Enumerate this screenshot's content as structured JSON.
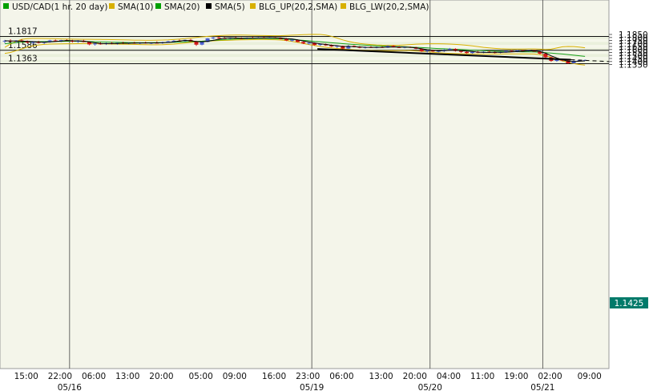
{
  "chart_data": {
    "type": "line",
    "title": "USD/CAD(1 hr. 20 day)",
    "legend": [
      {
        "label": "USD/CAD(1 hr. 20 day)",
        "color": "#00a000"
      },
      {
        "label": "SMA(10)",
        "color": "#d8b000"
      },
      {
        "label": "SMA(20)",
        "color": "#00a000"
      },
      {
        "label": "SMA(5)",
        "color": "#000000"
      },
      {
        "label": "BLG_UP(20,2,SMA)",
        "color": "#d8b000"
      },
      {
        "label": "BLG_LW(20,2,SMA)",
        "color": "#d8b000"
      }
    ],
    "legend_position": "top-left",
    "ylim": [
      1.1325,
      1.1895
    ],
    "y_ticks": [
      "1.1850",
      "1.1800",
      "1.1750",
      "1.1700",
      "1.1650",
      "1.1600",
      "1.1550",
      "1.1500",
      "1.1450",
      "1.1400",
      "1.1350"
    ],
    "x_tick_labels": [
      "15:00",
      "22:00",
      "06:00",
      "13:00",
      "20:00",
      "05:00",
      "09:00",
      "16:00",
      "23:00",
      "06:00",
      "13:00",
      "20:00",
      "04:00",
      "11:00",
      "19:00",
      "02:00",
      "09:00"
    ],
    "date_labels": [
      "05/16",
      "05/19",
      "05/20",
      "05/21"
    ],
    "horizontal_lines": [
      {
        "label": "1.1817",
        "value": 1.1817
      },
      {
        "label": "1.1586",
        "value": 1.1586
      },
      {
        "label": "1.1363",
        "value": 1.1363
      }
    ],
    "current_price": {
      "label": "1.1425",
      "value": 1.1425,
      "color": "#007a6a"
    },
    "up_color": "#4a5fd0",
    "down_color": "#d01818",
    "candles": [
      [
        1.1735,
        1.176,
        1.1705,
        1.1745
      ],
      [
        1.1745,
        1.177,
        1.1725,
        1.1735
      ],
      [
        1.1735,
        1.1755,
        1.171,
        1.175
      ],
      [
        1.175,
        1.177,
        1.172,
        1.173
      ],
      [
        1.173,
        1.175,
        1.1705,
        1.1715
      ],
      [
        1.1715,
        1.173,
        1.1695,
        1.1725
      ],
      [
        1.1725,
        1.1745,
        1.17,
        1.171
      ],
      [
        1.171,
        1.1735,
        1.169,
        1.1728
      ],
      [
        1.1728,
        1.176,
        1.1715,
        1.175
      ],
      [
        1.175,
        1.1765,
        1.173,
        1.174
      ],
      [
        1.174,
        1.176,
        1.1725,
        1.1755
      ],
      [
        1.1755,
        1.177,
        1.174,
        1.1745
      ],
      [
        1.1745,
        1.176,
        1.1715,
        1.173
      ],
      [
        1.173,
        1.1755,
        1.171,
        1.1745
      ],
      [
        1.1745,
        1.176,
        1.172,
        1.1725
      ],
      [
        1.1725,
        1.1735,
        1.167,
        1.1685
      ],
      [
        1.1685,
        1.171,
        1.1665,
        1.17
      ],
      [
        1.17,
        1.172,
        1.168,
        1.169
      ],
      [
        1.169,
        1.1715,
        1.1675,
        1.1705
      ],
      [
        1.1705,
        1.1725,
        1.1685,
        1.1695
      ],
      [
        1.1695,
        1.1715,
        1.168,
        1.171
      ],
      [
        1.171,
        1.173,
        1.169,
        1.17
      ],
      [
        1.17,
        1.1718,
        1.1688,
        1.1712
      ],
      [
        1.1712,
        1.1728,
        1.1695,
        1.1702
      ],
      [
        1.1702,
        1.1722,
        1.169,
        1.1715
      ],
      [
        1.1715,
        1.173,
        1.1698,
        1.1705
      ],
      [
        1.1705,
        1.172,
        1.169,
        1.1712
      ],
      [
        1.1712,
        1.1735,
        1.17,
        1.1708
      ],
      [
        1.1708,
        1.173,
        1.1695,
        1.1722
      ],
      [
        1.1722,
        1.1745,
        1.171,
        1.1735
      ],
      [
        1.1735,
        1.1755,
        1.172,
        1.1745
      ],
      [
        1.1745,
        1.1765,
        1.173,
        1.174
      ],
      [
        1.174,
        1.1765,
        1.173,
        1.176
      ],
      [
        1.176,
        1.1775,
        1.1725,
        1.1735
      ],
      [
        1.1735,
        1.1745,
        1.166,
        1.168
      ],
      [
        1.168,
        1.1735,
        1.167,
        1.1725
      ],
      [
        1.1725,
        1.179,
        1.172,
        1.1785
      ],
      [
        1.1785,
        1.181,
        1.177,
        1.18
      ],
      [
        1.18,
        1.181,
        1.1775,
        1.179
      ],
      [
        1.179,
        1.1808,
        1.1775,
        1.1782
      ],
      [
        1.1782,
        1.18,
        1.177,
        1.1795
      ],
      [
        1.1795,
        1.181,
        1.178,
        1.1788
      ],
      [
        1.1788,
        1.1802,
        1.1775,
        1.178
      ],
      [
        1.178,
        1.18,
        1.177,
        1.1795
      ],
      [
        1.1795,
        1.181,
        1.1785,
        1.179
      ],
      [
        1.179,
        1.1805,
        1.178,
        1.1798
      ],
      [
        1.1798,
        1.1808,
        1.1788,
        1.1792
      ],
      [
        1.1792,
        1.1805,
        1.1782,
        1.18
      ],
      [
        1.18,
        1.1806,
        1.1785,
        1.179
      ],
      [
        1.179,
        1.18,
        1.177,
        1.1775
      ],
      [
        1.1775,
        1.179,
        1.174,
        1.175
      ],
      [
        1.175,
        1.177,
        1.173,
        1.176
      ],
      [
        1.176,
        1.1765,
        1.172,
        1.1725
      ],
      [
        1.1725,
        1.1735,
        1.169,
        1.17
      ],
      [
        1.17,
        1.172,
        1.168,
        1.171
      ],
      [
        1.171,
        1.1718,
        1.1665,
        1.1675
      ],
      [
        1.1675,
        1.17,
        1.166,
        1.169
      ],
      [
        1.169,
        1.17,
        1.166,
        1.1668
      ],
      [
        1.1668,
        1.1685,
        1.164,
        1.165
      ],
      [
        1.165,
        1.167,
        1.1625,
        1.166
      ],
      [
        1.166,
        1.1665,
        1.1605,
        1.1615
      ],
      [
        1.1615,
        1.1675,
        1.161,
        1.166
      ],
      [
        1.166,
        1.167,
        1.1635,
        1.1645
      ],
      [
        1.1645,
        1.1655,
        1.162,
        1.1628
      ],
      [
        1.1628,
        1.165,
        1.1615,
        1.164
      ],
      [
        1.164,
        1.1655,
        1.1625,
        1.1632
      ],
      [
        1.1632,
        1.1648,
        1.162,
        1.164
      ],
      [
        1.164,
        1.1652,
        1.1625,
        1.163
      ],
      [
        1.163,
        1.1668,
        1.1625,
        1.166
      ],
      [
        1.166,
        1.167,
        1.1635,
        1.164
      ],
      [
        1.164,
        1.1655,
        1.1625,
        1.1632
      ],
      [
        1.1632,
        1.1648,
        1.162,
        1.1642
      ],
      [
        1.1642,
        1.165,
        1.1628,
        1.1635
      ],
      [
        1.1635,
        1.1645,
        1.1605,
        1.1612
      ],
      [
        1.1612,
        1.162,
        1.156,
        1.157
      ],
      [
        1.157,
        1.159,
        1.155,
        1.158
      ],
      [
        1.158,
        1.1595,
        1.156,
        1.1568
      ],
      [
        1.1568,
        1.1585,
        1.1552,
        1.1575
      ],
      [
        1.1575,
        1.1605,
        1.156,
        1.1595
      ],
      [
        1.1595,
        1.1625,
        1.1585,
        1.161
      ],
      [
        1.161,
        1.162,
        1.1565,
        1.1575
      ],
      [
        1.1575,
        1.159,
        1.1545,
        1.156
      ],
      [
        1.156,
        1.1575,
        1.153,
        1.154
      ],
      [
        1.154,
        1.157,
        1.153,
        1.156
      ],
      [
        1.156,
        1.1575,
        1.154,
        1.1548
      ],
      [
        1.1548,
        1.157,
        1.1538,
        1.1562
      ],
      [
        1.1562,
        1.1578,
        1.1548,
        1.1555
      ],
      [
        1.1555,
        1.1568,
        1.1535,
        1.1545
      ],
      [
        1.1545,
        1.1565,
        1.1535,
        1.1558
      ],
      [
        1.1558,
        1.158,
        1.1548,
        1.1575
      ],
      [
        1.1575,
        1.159,
        1.156,
        1.1565
      ],
      [
        1.1565,
        1.159,
        1.1555,
        1.1582
      ],
      [
        1.1582,
        1.1595,
        1.1565,
        1.1572
      ],
      [
        1.1572,
        1.1595,
        1.1565,
        1.1588
      ],
      [
        1.1588,
        1.1592,
        1.156,
        1.1565
      ],
      [
        1.1565,
        1.1575,
        1.152,
        1.153
      ],
      [
        1.153,
        1.1545,
        1.146,
        1.147
      ],
      [
        1.147,
        1.148,
        1.1395,
        1.141
      ],
      [
        1.141,
        1.144,
        1.1395,
        1.143
      ],
      [
        1.143,
        1.1445,
        1.1405,
        1.1415
      ],
      [
        1.1415,
        1.1425,
        1.136,
        1.137
      ],
      [
        1.137,
        1.142,
        1.1365,
        1.141
      ],
      [
        1.141,
        1.1432,
        1.1405,
        1.142
      ],
      [
        1.142,
        1.1432,
        1.1415,
        1.1425
      ]
    ],
    "sma5": [
      1.1745,
      1.1742,
      1.174,
      1.1738,
      1.1735,
      1.1731,
      1.1725,
      1.1721,
      1.1726,
      1.1733,
      1.174,
      1.1748,
      1.1745,
      1.1743,
      1.1738,
      1.1726,
      1.1712,
      1.17,
      1.1697,
      1.1698,
      1.1698,
      1.1704,
      1.1703,
      1.1706,
      1.1706,
      1.1709,
      1.1709,
      1.171,
      1.1712,
      1.1717,
      1.1727,
      1.1742,
      1.175,
      1.1746,
      1.1732,
      1.1728,
      1.1737,
      1.1752,
      1.177,
      1.179,
      1.1793,
      1.1791,
      1.1787,
      1.179,
      1.179,
      1.1791,
      1.1793,
      1.1795,
      1.1796,
      1.1791,
      1.1781,
      1.1775,
      1.176,
      1.1742,
      1.1725,
      1.1708,
      1.1694,
      1.1684,
      1.167,
      1.1663,
      1.1648,
      1.1652,
      1.1645,
      1.1642,
      1.1637,
      1.1636,
      1.1634,
      1.1636,
      1.1639,
      1.164,
      1.1641,
      1.164,
      1.1636,
      1.1626,
      1.1611,
      1.1597,
      1.1584,
      1.1578,
      1.158,
      1.1588,
      1.1588,
      1.158,
      1.1573,
      1.1566,
      1.1556,
      1.1552,
      1.155,
      1.1556,
      1.1553,
      1.1556,
      1.156,
      1.1565,
      1.157,
      1.1577,
      1.1578,
      1.1568,
      1.1538,
      1.1494,
      1.1458,
      1.1429,
      1.1404,
      1.1398,
      1.1405,
      1.141
    ],
    "sma20": [
      1.1695,
      1.1705,
      1.1713,
      1.172,
      1.1725,
      1.1727,
      1.173,
      1.1732,
      1.1734,
      1.1735,
      1.1736,
      1.1737,
      1.1737,
      1.1736,
      1.1735,
      1.1732,
      1.1729,
      1.1726,
      1.1724,
      1.1722,
      1.172,
      1.1718,
      1.1716,
      1.1715,
      1.1714,
      1.1714,
      1.1714,
      1.1715,
      1.1716,
      1.1718,
      1.172,
      1.1723,
      1.1727,
      1.1731,
      1.1734,
      1.1738,
      1.1745,
      1.1752,
      1.1758,
      1.1764,
      1.1769,
      1.1773,
      1.1777,
      1.178,
      1.1782,
      1.1783,
      1.1783,
      1.1782,
      1.178,
      1.1776,
      1.1771,
      1.1765,
      1.1758,
      1.1751,
      1.1744,
      1.1736,
      1.1728,
      1.172,
      1.1712,
      1.1705,
      1.1697,
      1.169,
      1.1683,
      1.1677,
      1.1671,
      1.1666,
      1.1661,
      1.1657,
      1.1653,
      1.165,
      1.1647,
      1.1644,
      1.164,
      1.1636,
      1.1631,
      1.1626,
      1.1621,
      1.1616,
      1.1611,
      1.1607,
      1.1603,
      1.1598,
      1.1594,
      1.1589,
      1.1584,
      1.158,
      1.1576,
      1.1573,
      1.157,
      1.1567,
      1.1565,
      1.1563,
      1.1561,
      1.156,
      1.1558,
      1.1554,
      1.1548,
      1.154,
      1.1532,
      1.1524,
      1.1515,
      1.1505,
      1.1495,
      1.1485
    ],
    "bb_upper": [
      1.1635,
      1.169,
      1.1735,
      1.1768,
      1.178,
      1.1784,
      1.1784,
      1.1782,
      1.178,
      1.1778,
      1.1776,
      1.1774,
      1.1772,
      1.177,
      1.1769,
      1.1768,
      1.1767,
      1.1766,
      1.1765,
      1.1764,
      1.1762,
      1.176,
      1.1758,
      1.1756,
      1.1755,
      1.1754,
      1.1754,
      1.1755,
      1.1757,
      1.176,
      1.1765,
      1.1772,
      1.178,
      1.179,
      1.18,
      1.181,
      1.1818,
      1.1825,
      1.183,
      1.1835,
      1.1838,
      1.184,
      1.184,
      1.1838,
      1.1836,
      1.1834,
      1.1832,
      1.183,
      1.1828,
      1.183,
      1.1834,
      1.1838,
      1.1842,
      1.1846,
      1.185,
      1.1852,
      1.185,
      1.184,
      1.182,
      1.179,
      1.176,
      1.1735,
      1.1715,
      1.17,
      1.169,
      1.1682,
      1.1676,
      1.1672,
      1.167,
      1.1668,
      1.167,
      1.1675,
      1.1682,
      1.1688,
      1.1692,
      1.1695,
      1.1696,
      1.1696,
      1.1694,
      1.169,
      1.1685,
      1.1678,
      1.167,
      1.166,
      1.1648,
      1.1636,
      1.1626,
      1.1618,
      1.1612,
      1.1608,
      1.1606,
      1.1606,
      1.1607,
      1.1608,
      1.1608,
      1.1605,
      1.1598,
      1.1605,
      1.1625,
      1.1645,
      1.165,
      1.1648,
      1.164,
      1.1628
    ],
    "bb_lower": [
      1.1535,
      1.155,
      1.158,
      1.161,
      1.164,
      1.166,
      1.1675,
      1.1685,
      1.169,
      1.1692,
      1.1694,
      1.1695,
      1.1696,
      1.1697,
      1.1698,
      1.1698,
      1.1697,
      1.1696,
      1.1694,
      1.1692,
      1.169,
      1.1688,
      1.1686,
      1.1684,
      1.1682,
      1.168,
      1.1678,
      1.1678,
      1.168,
      1.1684,
      1.169,
      1.1698,
      1.1708,
      1.1718,
      1.1726,
      1.1732,
      1.1738,
      1.1743,
      1.1748,
      1.1752,
      1.1755,
      1.1758,
      1.176,
      1.1762,
      1.1764,
      1.1765,
      1.1765,
      1.1764,
      1.1762,
      1.1757,
      1.1748,
      1.1735,
      1.1718,
      1.17,
      1.1682,
      1.1665,
      1.165,
      1.1637,
      1.1626,
      1.1617,
      1.1609,
      1.1602,
      1.1596,
      1.159,
      1.1586,
      1.1583,
      1.1581,
      1.158,
      1.158,
      1.1581,
      1.1582,
      1.1582,
      1.158,
      1.1576,
      1.157,
      1.1562,
      1.1554,
      1.1547,
      1.1541,
      1.1536,
      1.1532,
      1.1529,
      1.1527,
      1.1525,
      1.1524,
      1.1523,
      1.1523,
      1.1524,
      1.1525,
      1.1526,
      1.1527,
      1.1528,
      1.1528,
      1.1527,
      1.1524,
      1.1515,
      1.1495,
      1.147,
      1.144,
      1.141,
      1.1385,
      1.1365,
      1.135,
      1.134
    ]
  }
}
